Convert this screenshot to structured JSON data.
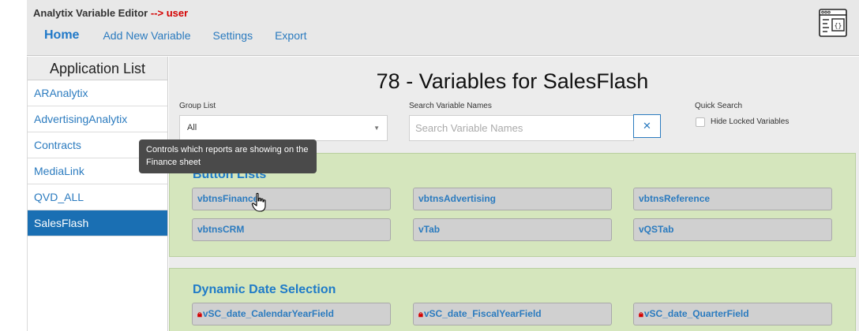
{
  "header": {
    "app_name": "Analytix Variable Editor",
    "arrow": "-->",
    "user": "user",
    "nav": [
      {
        "label": "Home",
        "active": true
      },
      {
        "label": "Add New Variable",
        "active": false
      },
      {
        "label": "Settings",
        "active": false
      },
      {
        "label": "Export",
        "active": false
      }
    ],
    "logo_icon": "code-window-icon"
  },
  "sidebar": {
    "title": "Application List",
    "items": [
      {
        "label": "ARAnalytix",
        "selected": false
      },
      {
        "label": "AdvertisingAnalytix",
        "selected": false
      },
      {
        "label": "Contracts",
        "selected": false
      },
      {
        "label": "MediaLink",
        "selected": false
      },
      {
        "label": "QVD_ALL",
        "selected": false
      },
      {
        "label": "SalesFlash",
        "selected": true
      }
    ]
  },
  "main": {
    "title": "78 - Variables for SalesFlash",
    "filters": {
      "group_label": "Group List",
      "group_value": "All",
      "search_label": "Search Variable Names",
      "search_placeholder": "Search Variable Names",
      "clear_label": "✕",
      "quick_label": "Quick Search",
      "hide_locked_label": "Hide Locked Variables",
      "hide_locked_checked": false
    },
    "groups": [
      {
        "title": "Button Lists",
        "variables": [
          {
            "name": "vbtnsFinance",
            "locked": false
          },
          {
            "name": "vbtnsAdvertising",
            "locked": false
          },
          {
            "name": "vbtnsReference",
            "locked": false
          },
          {
            "name": "vbtnsCRM",
            "locked": false
          },
          {
            "name": "vTab",
            "locked": false
          },
          {
            "name": "vQSTab",
            "locked": false
          }
        ]
      },
      {
        "title": "Dynamic Date Selection",
        "variables": [
          {
            "name": "vSC_date_CalendarYearField",
            "locked": true
          },
          {
            "name": "vSC_date_FiscalYearField",
            "locked": true
          },
          {
            "name": "vSC_date_QuarterField",
            "locked": true
          }
        ]
      }
    ]
  },
  "tooltip": {
    "text": "Controls which reports are showing on the Finance sheet"
  },
  "colors": {
    "accent": "#1f78c8",
    "selected_bg": "#1a6fb3",
    "group_bg": "#d5e6bd",
    "lock": "#d40000"
  }
}
